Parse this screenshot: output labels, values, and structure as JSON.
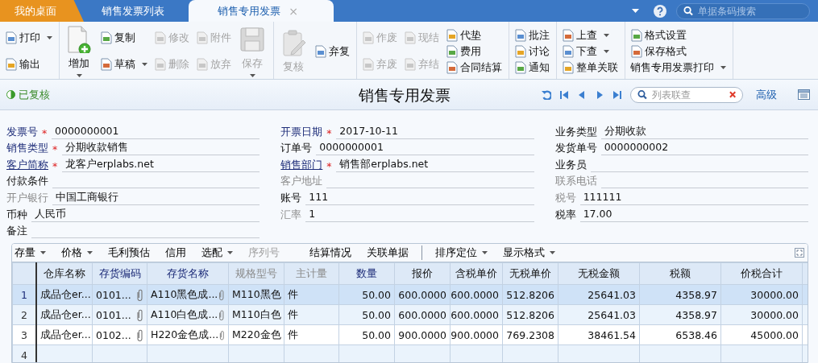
{
  "tabs": [
    {
      "label": "我的桌面",
      "kind": "home",
      "selected": false
    },
    {
      "label": "销售发票列表",
      "kind": "doc",
      "selected": false
    },
    {
      "label": "销售专用发票",
      "kind": "doc",
      "selected": true,
      "close": "×"
    }
  ],
  "header_search": {
    "placeholder": "单据条码搜索"
  },
  "toolbar": [
    {
      "columns": [
        {
          "items": [
            {
              "label": "打印",
              "disabled": false,
              "dropdown": true
            },
            {
              "label": "输出",
              "disabled": false,
              "dropdown": false
            }
          ]
        }
      ]
    },
    {
      "columns": [
        {
          "kind": "add",
          "items": [
            {
              "label": "增加",
              "disabled": false,
              "dropdown": true
            }
          ]
        },
        {
          "items": [
            {
              "label": "复制",
              "disabled": false,
              "dropdown": false
            },
            {
              "label": "草稿",
              "disabled": false,
              "dropdown": true
            }
          ]
        },
        {
          "items": [
            {
              "label": "修改",
              "disabled": true,
              "dropdown": false
            },
            {
              "label": "删除",
              "disabled": true,
              "dropdown": false
            }
          ]
        },
        {
          "items": [
            {
              "label": "附件",
              "disabled": true,
              "dropdown": false
            },
            {
              "label": "放弃",
              "disabled": true,
              "dropdown": false
            }
          ]
        },
        {
          "kind": "save",
          "items": [
            {
              "label": "保存",
              "disabled": true,
              "dropdown": true
            }
          ]
        }
      ]
    },
    {
      "columns": [
        {
          "kind": "review",
          "items": [
            {
              "label": "复核",
              "disabled": true,
              "dropdown": false
            }
          ]
        },
        {
          "items": [
            {
              "label": "弃复",
              "disabled": false,
              "dropdown": false
            }
          ]
        }
      ]
    },
    {
      "columns": [
        {
          "items": [
            {
              "label": "作废",
              "disabled": true,
              "dropdown": false
            },
            {
              "label": "弃废",
              "disabled": true,
              "dropdown": false
            }
          ]
        },
        {
          "items": [
            {
              "label": "现结",
              "disabled": true,
              "dropdown": false
            },
            {
              "label": "弃结",
              "disabled": true,
              "dropdown": false
            }
          ]
        },
        {
          "items": [
            {
              "label": "代垫",
              "disabled": false,
              "dropdown": false
            },
            {
              "label": "费用",
              "disabled": false,
              "dropdown": false
            },
            {
              "label": "合同结算",
              "disabled": false,
              "dropdown": false
            }
          ]
        }
      ]
    },
    {
      "columns": [
        {
          "items": [
            {
              "label": "批注",
              "disabled": false,
              "dropdown": false
            },
            {
              "label": "讨论",
              "disabled": false,
              "dropdown": false
            },
            {
              "label": "通知",
              "disabled": false,
              "dropdown": false
            }
          ]
        }
      ]
    },
    {
      "columns": [
        {
          "items": [
            {
              "label": "上查",
              "disabled": false,
              "dropdown": true
            },
            {
              "label": "下查",
              "disabled": false,
              "dropdown": true
            },
            {
              "label": "整单关联",
              "disabled": false,
              "dropdown": false
            }
          ]
        }
      ]
    },
    {
      "columns": [
        {
          "items": [
            {
              "label": "格式设置",
              "disabled": false,
              "dropdown": false
            },
            {
              "label": "保存格式",
              "disabled": false,
              "dropdown": false
            },
            {
              "kind": "text",
              "label": "销售专用发票打印",
              "disabled": false,
              "dropdown": true
            }
          ]
        }
      ]
    }
  ],
  "status": {
    "label": "已复核"
  },
  "title": "销售专用发票",
  "list_search": {
    "placeholder": "列表联查"
  },
  "advanced_link": "高级",
  "form": [
    [
      {
        "label": "发票号",
        "kind": "strong",
        "required_mark": "*",
        "value": "0000000001"
      },
      {
        "label": "销售类型",
        "kind": "strong",
        "required_mark": "*",
        "value": "分期收款销售"
      },
      {
        "label": "客户简称",
        "kind": "link",
        "required_mark": "*",
        "value": "龙客户erplabs.net"
      },
      {
        "label": "付款条件",
        "kind": "plain"
      },
      {
        "label": "开户银行",
        "kind": "muted",
        "value": "中国工商银行"
      },
      {
        "label": "币种",
        "kind": "plain",
        "value": "人民币"
      },
      {
        "label": "备注",
        "kind": "plain"
      }
    ],
    [
      {
        "label": "开票日期",
        "kind": "strong",
        "required_mark": "*",
        "value": "2017-10-11"
      },
      {
        "label": "订单号",
        "kind": "plain",
        "value": "0000000001"
      },
      {
        "label": "销售部门",
        "kind": "link",
        "required_mark": "*",
        "value": "销售部erplabs.net"
      },
      {
        "label": "客户地址",
        "kind": "muted"
      },
      {
        "label": "账号",
        "kind": "plain",
        "value": "111"
      },
      {
        "label": "汇率",
        "kind": "muted",
        "value": "1"
      }
    ],
    [
      {
        "label": "业务类型",
        "kind": "plain",
        "value": "分期收款"
      },
      {
        "label": "发货单号",
        "kind": "plain",
        "value": "0000000002"
      },
      {
        "label": "业务员",
        "kind": "plain"
      },
      {
        "label": "联系电话",
        "kind": "muted"
      },
      {
        "label": "税号",
        "kind": "muted",
        "value": "111111"
      },
      {
        "label": "税率",
        "kind": "plain",
        "value": "17.00"
      }
    ]
  ],
  "table_toolbar": [
    {
      "label": "存量",
      "disabled": false,
      "dropdown": true
    },
    {
      "label": "价格",
      "disabled": false,
      "dropdown": true
    },
    {
      "label": "毛利预估",
      "disabled": false,
      "dropdown": false
    },
    {
      "label": "信用",
      "disabled": false,
      "dropdown": false
    },
    {
      "label": "选配",
      "disabled": false,
      "dropdown": true
    },
    {
      "label": "序列号",
      "disabled": true,
      "dropdown": false
    },
    {
      "label": "结算情况",
      "disabled": false,
      "dropdown": false
    },
    {
      "label": "关联单据",
      "disabled": false,
      "dropdown": false
    },
    {
      "label": "排序定位",
      "disabled": false,
      "dropdown": true,
      "separator": true
    },
    {
      "label": "显示格式",
      "disabled": false,
      "dropdown": true
    }
  ],
  "table": {
    "columns": [
      {
        "label": "仓库名称",
        "kind": "plain"
      },
      {
        "label": "存货编码",
        "kind": "strong"
      },
      {
        "label": "存货名称",
        "kind": "strong"
      },
      {
        "label": "规格型号",
        "kind": "muted"
      },
      {
        "label": "主计量",
        "kind": "muted"
      },
      {
        "label": "数量",
        "kind": "strong"
      },
      {
        "label": "报价",
        "kind": "plain"
      },
      {
        "label": "含税单价",
        "kind": "plain"
      },
      {
        "label": "无税单价",
        "kind": "plain"
      },
      {
        "label": "无税金额",
        "kind": "plain"
      },
      {
        "label": "税额",
        "kind": "plain"
      },
      {
        "label": "价税合计",
        "kind": "plain"
      }
    ],
    "rows": [
      {
        "number": "1",
        "selected": true,
        "cells": [
          "成品仓er...",
          "0101...",
          "A110黑色成...",
          "M110黑色",
          "件",
          "50.00",
          "600.0000",
          "600.0000",
          "512.8206",
          "25641.03",
          "4358.97",
          "30000.00"
        ]
      },
      {
        "number": "2",
        "selected": false,
        "cells": [
          "成品仓er...",
          "0101...",
          "A110白色成...",
          "M110白色",
          "件",
          "50.00",
          "600.0000",
          "600.0000",
          "512.8206",
          "25641.03",
          "4358.97",
          "30000.00"
        ]
      },
      {
        "number": "3",
        "selected": false,
        "cells": [
          "成品仓er...",
          "0102...",
          "H220金色成...",
          "M220金色",
          "件",
          "50.00",
          "900.0000",
          "900.0000",
          "769.2308",
          "38461.54",
          "6538.46",
          "45000.00"
        ]
      },
      {
        "number": "4",
        "selected": false
      }
    ]
  }
}
